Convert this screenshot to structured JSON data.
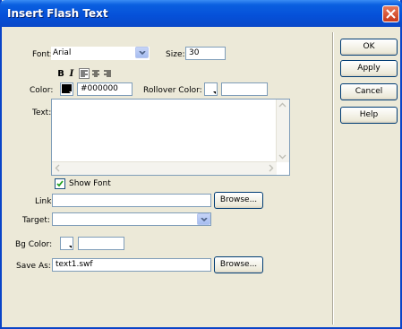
{
  "window": {
    "title": "Insert Flash Text"
  },
  "font": {
    "label": "Font:",
    "value": "Arial"
  },
  "size": {
    "label": "Size:",
    "value": "30"
  },
  "formatting": {
    "bold": "B",
    "italic": "I"
  },
  "color": {
    "label": "Color:",
    "value": "#000000",
    "swatch": "#000000"
  },
  "rollover": {
    "label": "Rollover Color:",
    "value": ""
  },
  "text": {
    "label": "Text:",
    "value": ""
  },
  "show_font": {
    "label": "Show Font",
    "checked": true
  },
  "link": {
    "label": "Link:",
    "value": "",
    "browse": "Browse..."
  },
  "target": {
    "label": "Target:",
    "value": ""
  },
  "bgcolor": {
    "label": "Bg Color:",
    "value": ""
  },
  "saveas": {
    "label": "Save As:",
    "value": "text1.swf",
    "browse": "Browse..."
  },
  "buttons": {
    "ok": "OK",
    "apply": "Apply",
    "cancel": "Cancel",
    "help": "Help"
  },
  "icons": {
    "close": "close-icon",
    "dropdown": "chevron-down-icon",
    "align_left": "align-left-icon",
    "align_center": "align-center-icon",
    "align_right": "align-right-icon",
    "check": "checkmark-icon"
  },
  "colors": {
    "titlebar": "#0550d8",
    "dialog_bg": "#ece9d8",
    "field_border": "#7f9db9",
    "close_red": "#c8391a"
  }
}
